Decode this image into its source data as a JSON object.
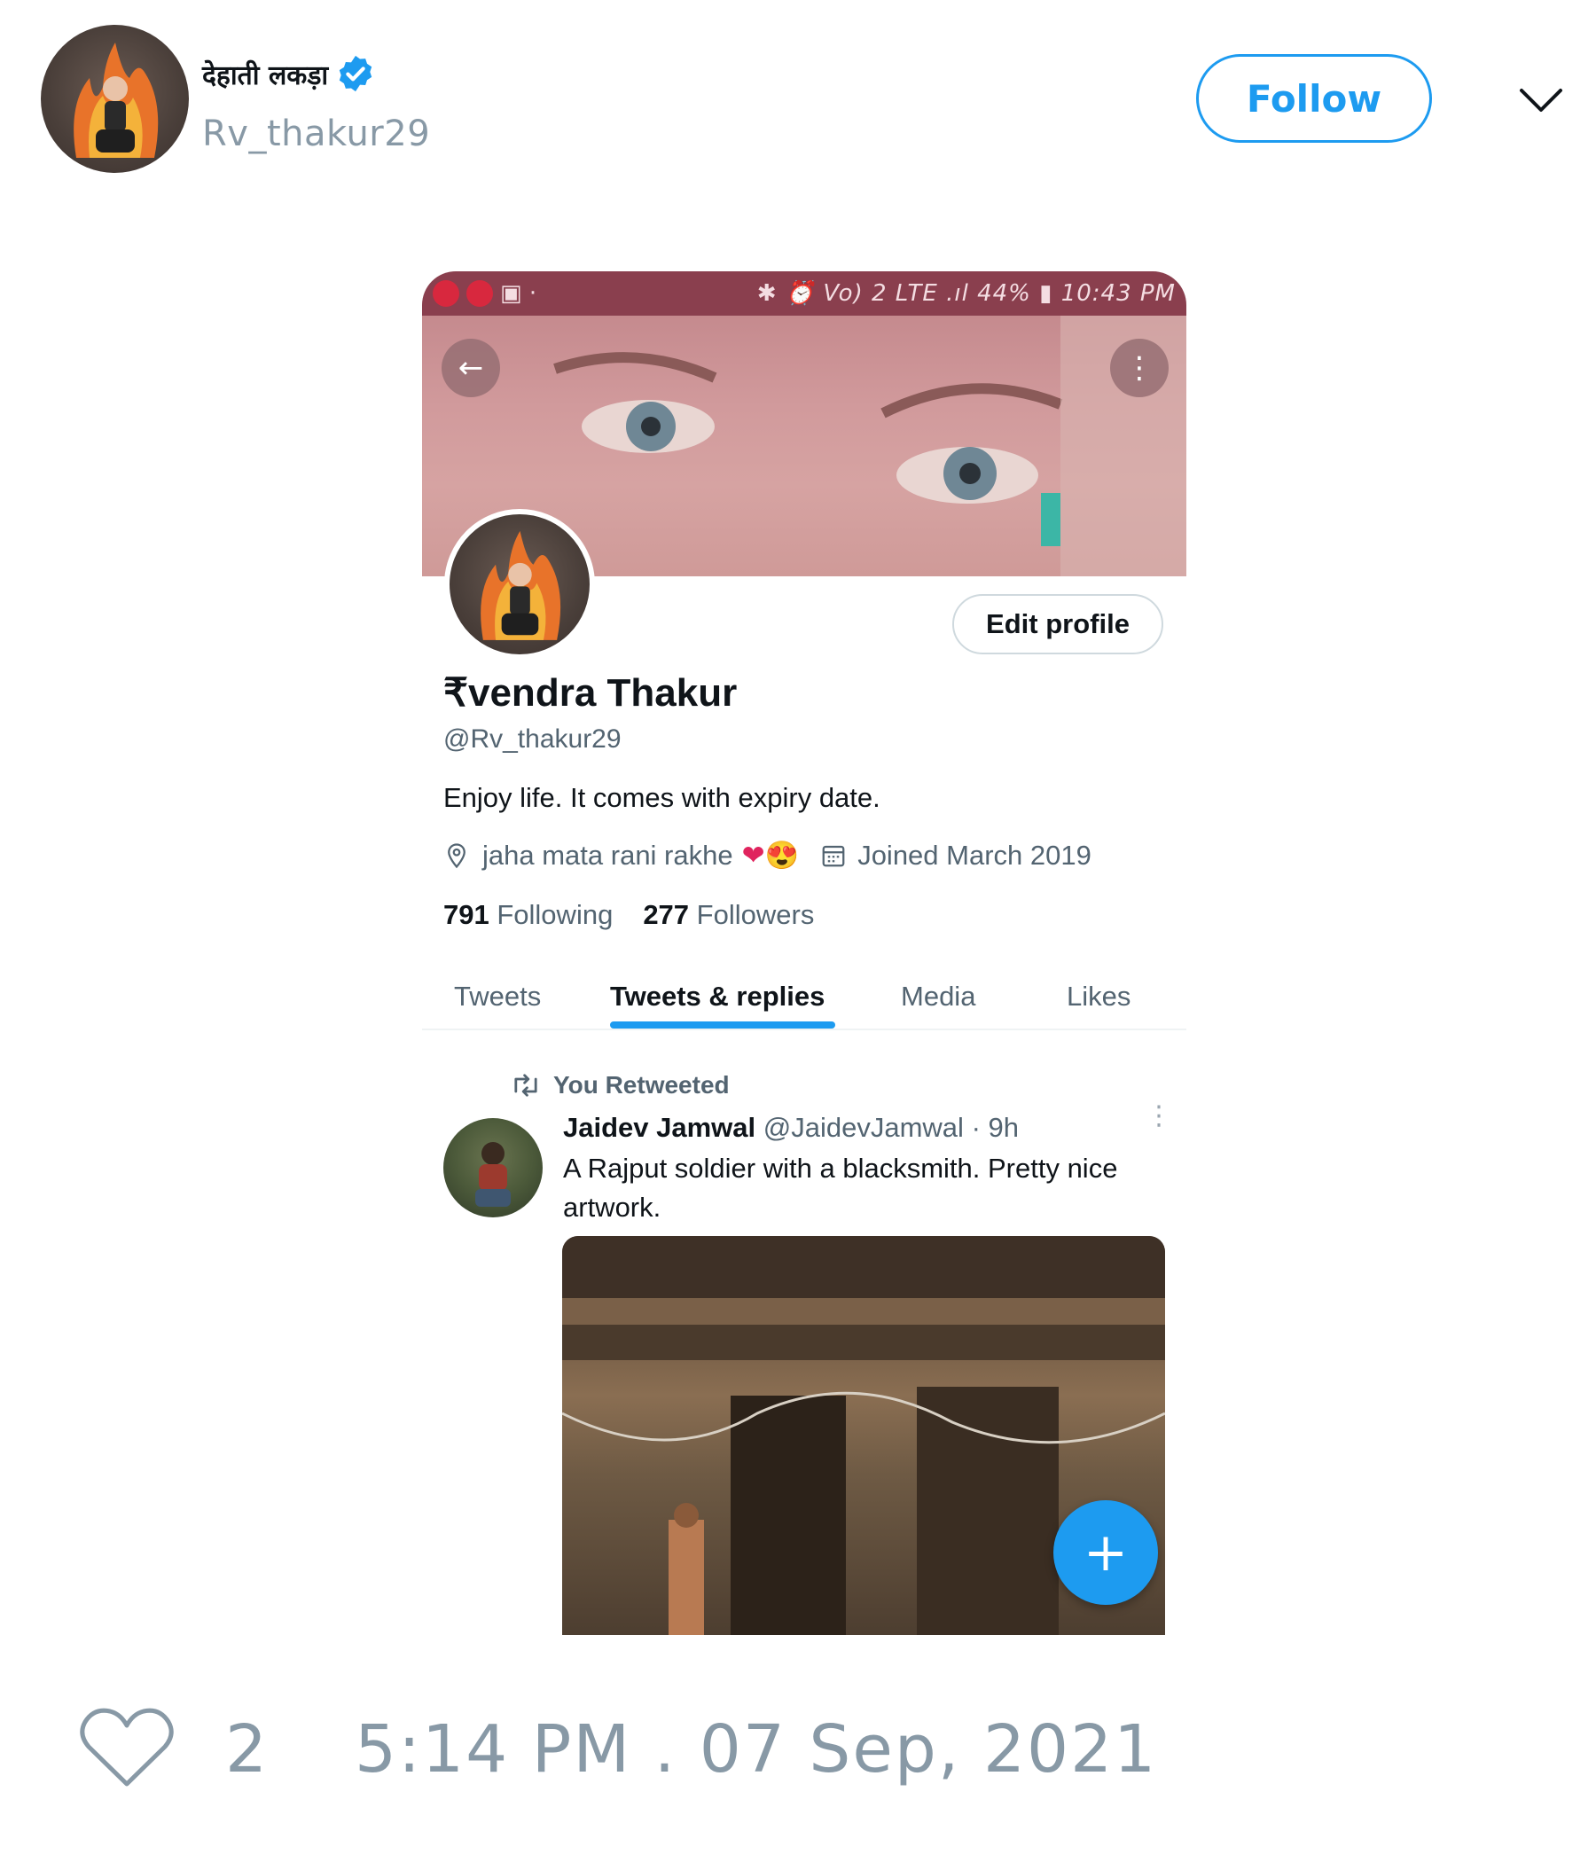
{
  "tweet": {
    "author": {
      "display_name": "देहाती लकड़ा",
      "handle": "Rv_thakur29",
      "verified": true,
      "avatar_icon": "avatar-image"
    },
    "follow_label": "Follow",
    "more_icon": "chevron-down-icon",
    "likes": "2",
    "timestamp": "5:14 PM . 07 Sep, 2021",
    "accent_color": "#1d9bf0",
    "muted_color": "#8899a6"
  },
  "screenshot": {
    "statusbar": {
      "right_text": "✱ ⏰ Vo) 2 LTE .ıl 44% ▮ 10:43 PM"
    },
    "profile": {
      "edit_label": "Edit profile",
      "name": "₹vendra Thakur",
      "handle": "@Rv_thakur29",
      "bio": "Enjoy life. It comes with expiry date.",
      "location": "jaha mata rani rakhe",
      "location_emoji": "❤😍",
      "joined": "Joined March 2019",
      "following_count": "791",
      "following_label": "Following",
      "followers_count": "277",
      "followers_label": "Followers"
    },
    "tabs": [
      "Tweets",
      "Tweets & replies",
      "Media",
      "Likes"
    ],
    "active_tab": "Tweets & replies",
    "retweet": {
      "label": "You Retweeted",
      "author_name": "Jaidev Jamwal",
      "author_handle": "@JaidevJamwal",
      "age": "· 9h",
      "text": "A Rajput soldier with a blacksmith. Pretty nice artwork."
    },
    "fab_label": "+"
  }
}
